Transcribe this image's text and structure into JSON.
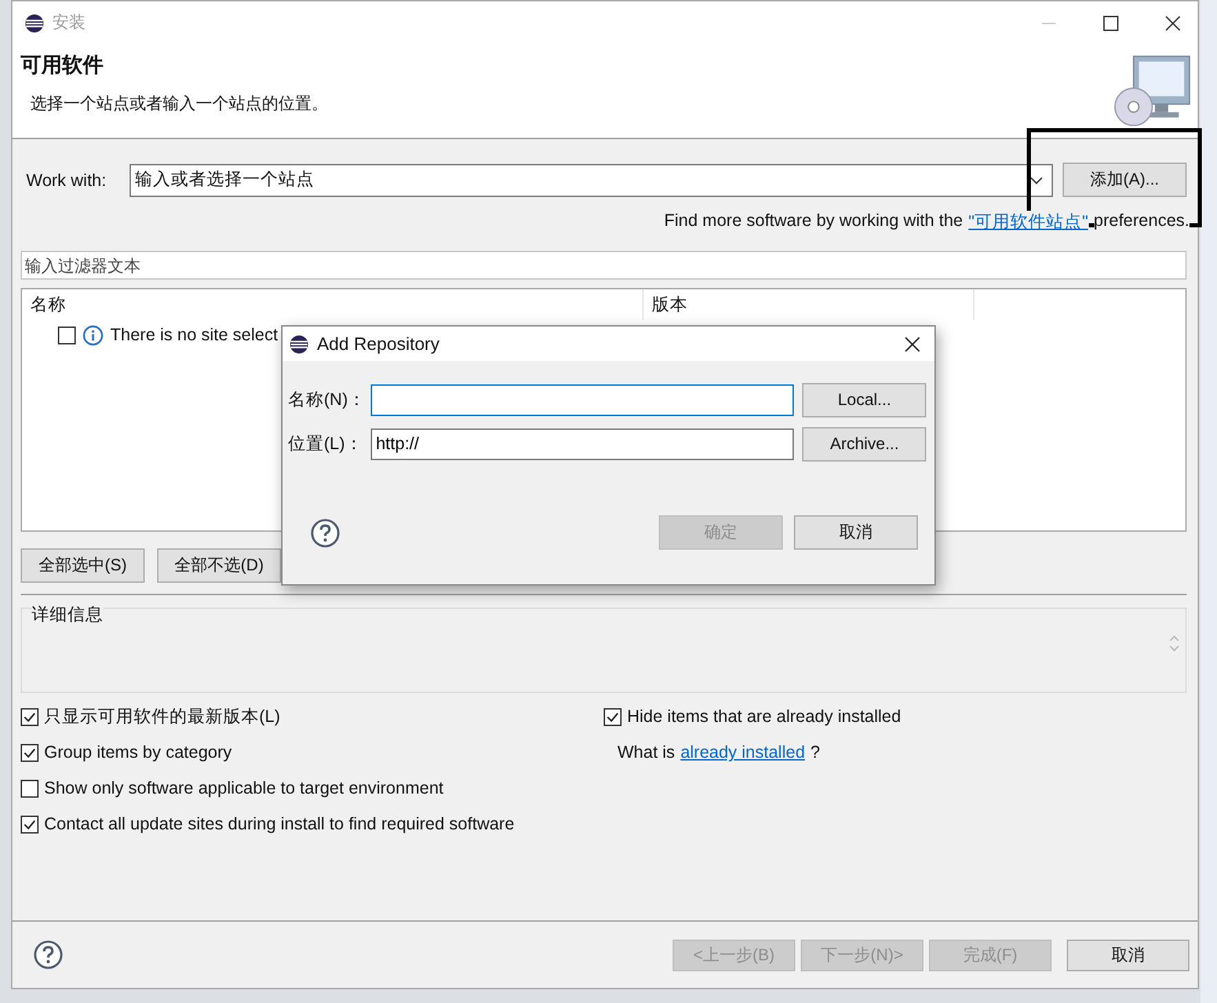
{
  "window": {
    "title": "安装"
  },
  "header": {
    "title": "可用软件",
    "description": "选择一个站点或者输入一个站点的位置。"
  },
  "work_with": {
    "label": "Work with:",
    "value": "输入或者选择一个站点",
    "button": "添加(A)..."
  },
  "find_more": {
    "text": "Find more software by working with the",
    "link": "\"可用软件站点\"",
    "suffix": "preferences."
  },
  "filter": {
    "placeholder": "输入过滤器文本"
  },
  "table": {
    "columns": [
      "名称",
      "版本"
    ],
    "rows": [
      {
        "checked": false,
        "text": "There is no site select"
      }
    ]
  },
  "select_buttons": [
    "全部选中(S)",
    "全部不选(D)"
  ],
  "details": {
    "title": "详细信息"
  },
  "options": [
    {
      "label": "只显示可用软件的最新版本(L)",
      "checked": true
    },
    {
      "label": "Group items by category",
      "checked": true
    },
    {
      "label": "Show only software applicable to target environment",
      "checked": false
    },
    {
      "label": "Contact all update sites during install to find required software",
      "checked": true
    }
  ],
  "right_options": {
    "hide": {
      "label": "Hide items that are already installed",
      "checked": true
    },
    "what_is": "What is",
    "link": "already installed",
    "suffix": "?"
  },
  "footer_buttons": [
    {
      "label": "<上一步(B)",
      "disabled": true
    },
    {
      "label": "下一步(N)>",
      "disabled": true
    },
    {
      "label": "完成(F)",
      "disabled": true
    },
    {
      "label": "取消",
      "disabled": false
    }
  ],
  "dialog": {
    "title": "Add Repository",
    "fields": [
      {
        "label": "名称(N)：",
        "focused": true,
        "button": "Local..."
      },
      {
        "label": "位置(L)：",
        "value": "http://",
        "focused": false,
        "button": "Archive..."
      }
    ],
    "buttons": [
      {
        "label": "确定",
        "disabled": true
      },
      {
        "label": "取消",
        "disabled": false
      }
    ]
  }
}
